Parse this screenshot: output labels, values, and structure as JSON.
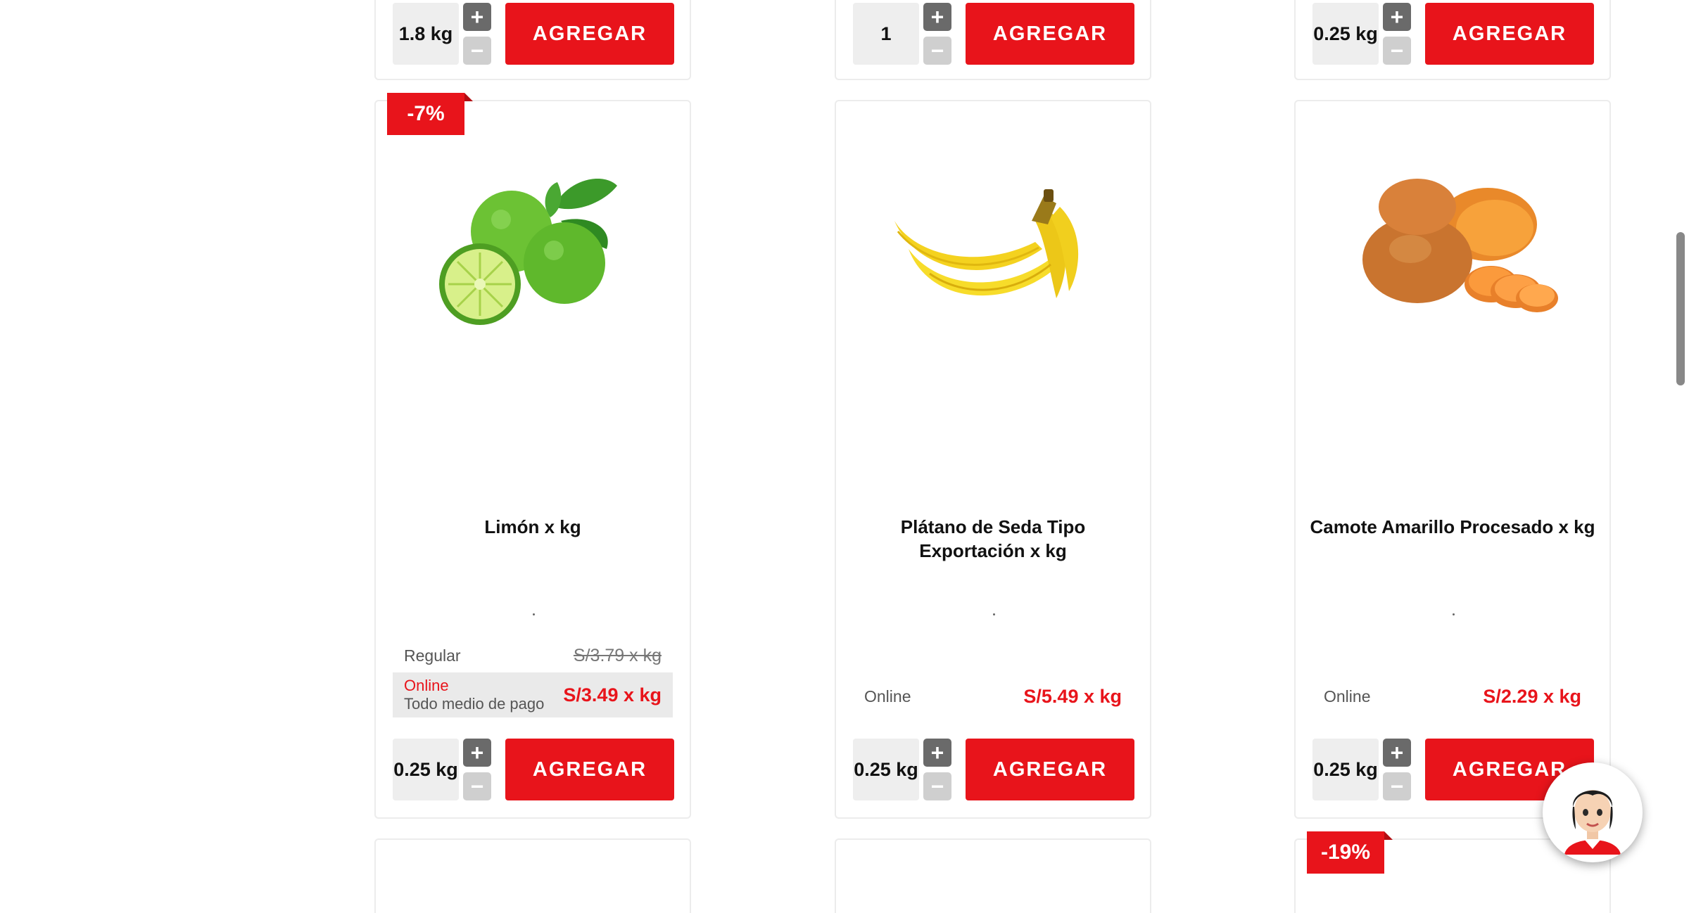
{
  "top_row": [
    {
      "qty": "1.8 kg",
      "add_label": "AGREGAR"
    },
    {
      "qty": "1",
      "add_label": "AGREGAR"
    },
    {
      "qty": "0.25 kg",
      "add_label": "AGREGAR"
    }
  ],
  "products": [
    {
      "name": "Limón x kg",
      "badge": "-7%",
      "image_icon": "lime-image",
      "regular_label": "Regular",
      "regular_price": "S/3.79 x kg",
      "online_label": "Online",
      "payment_label": "Todo medio de pago",
      "online_price": "S/3.49 x kg",
      "qty": "0.25 kg",
      "add_label": "AGREGAR"
    },
    {
      "name": "Plátano de Seda Tipo Exportación x kg",
      "image_icon": "banana-image",
      "online_label": "Online",
      "online_price": "S/5.49 x kg",
      "qty": "0.25 kg",
      "add_label": "AGREGAR"
    },
    {
      "name": "Camote Amarillo Procesado x kg",
      "image_icon": "sweet-potato-image",
      "online_label": "Online",
      "online_price": "S/2.29 x kg",
      "qty": "0.25 kg",
      "add_label": "AGREGAR"
    }
  ],
  "bottom_row": [
    {},
    {},
    {
      "badge": "-19%"
    }
  ],
  "controls": {
    "plus": "+",
    "minus": "−"
  },
  "colors": {
    "accent": "#e8141b",
    "card_border": "#ececec",
    "qty_bg": "#eeeeee"
  },
  "chat": {
    "icon": "assistant-avatar-icon"
  }
}
